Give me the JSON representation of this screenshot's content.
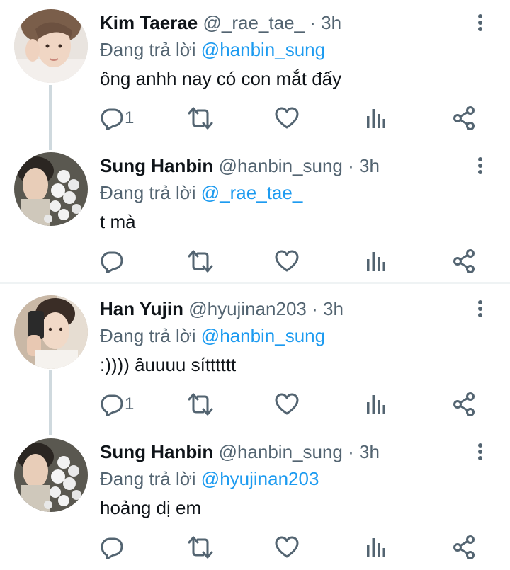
{
  "tweets": [
    {
      "name": "Kim Taerae",
      "handle": "@_rae_tae_",
      "separator": "·",
      "time": "3h",
      "reply_prefix": "Đang trả lời",
      "reply_to": "@hanbin_sung",
      "text": "ông anhh nay có con mắt đấy",
      "reply_count": "1",
      "avatar_icon": "selfie-avatar"
    },
    {
      "name": "Sung Hanbin",
      "handle": "@hanbin_sung",
      "separator": "·",
      "time": "3h",
      "reply_prefix": "Đang trả lời",
      "reply_to": "@_rae_tae_",
      "text": "t mà",
      "reply_count": "",
      "avatar_icon": "flowers-avatar"
    },
    {
      "name": "Han Yujin",
      "handle": "@hyujinan203",
      "separator": "·",
      "time": "3h",
      "reply_prefix": "Đang trả lời",
      "reply_to": "@hanbin_sung",
      "text": ":)))) âuuuu sítttttt",
      "reply_count": "1",
      "avatar_icon": "mirror-selfie-avatar"
    },
    {
      "name": "Sung Hanbin",
      "handle": "@hanbin_sung",
      "separator": "·",
      "time": "3h",
      "reply_prefix": "Đang trả lời",
      "reply_to": "@hyujinan203",
      "text": "hoảng dị em",
      "reply_count": "",
      "avatar_icon": "flowers-avatar"
    }
  ],
  "icons": {
    "reply": "reply-icon",
    "retweet": "retweet-icon",
    "like": "heart-icon",
    "views": "views-icon",
    "share": "share-icon",
    "more": "more-icon"
  },
  "colors": {
    "mention": "#1d9bf0",
    "secondary_text": "#536471",
    "primary_text": "#0f1419",
    "thread_line": "#cfd9de"
  }
}
